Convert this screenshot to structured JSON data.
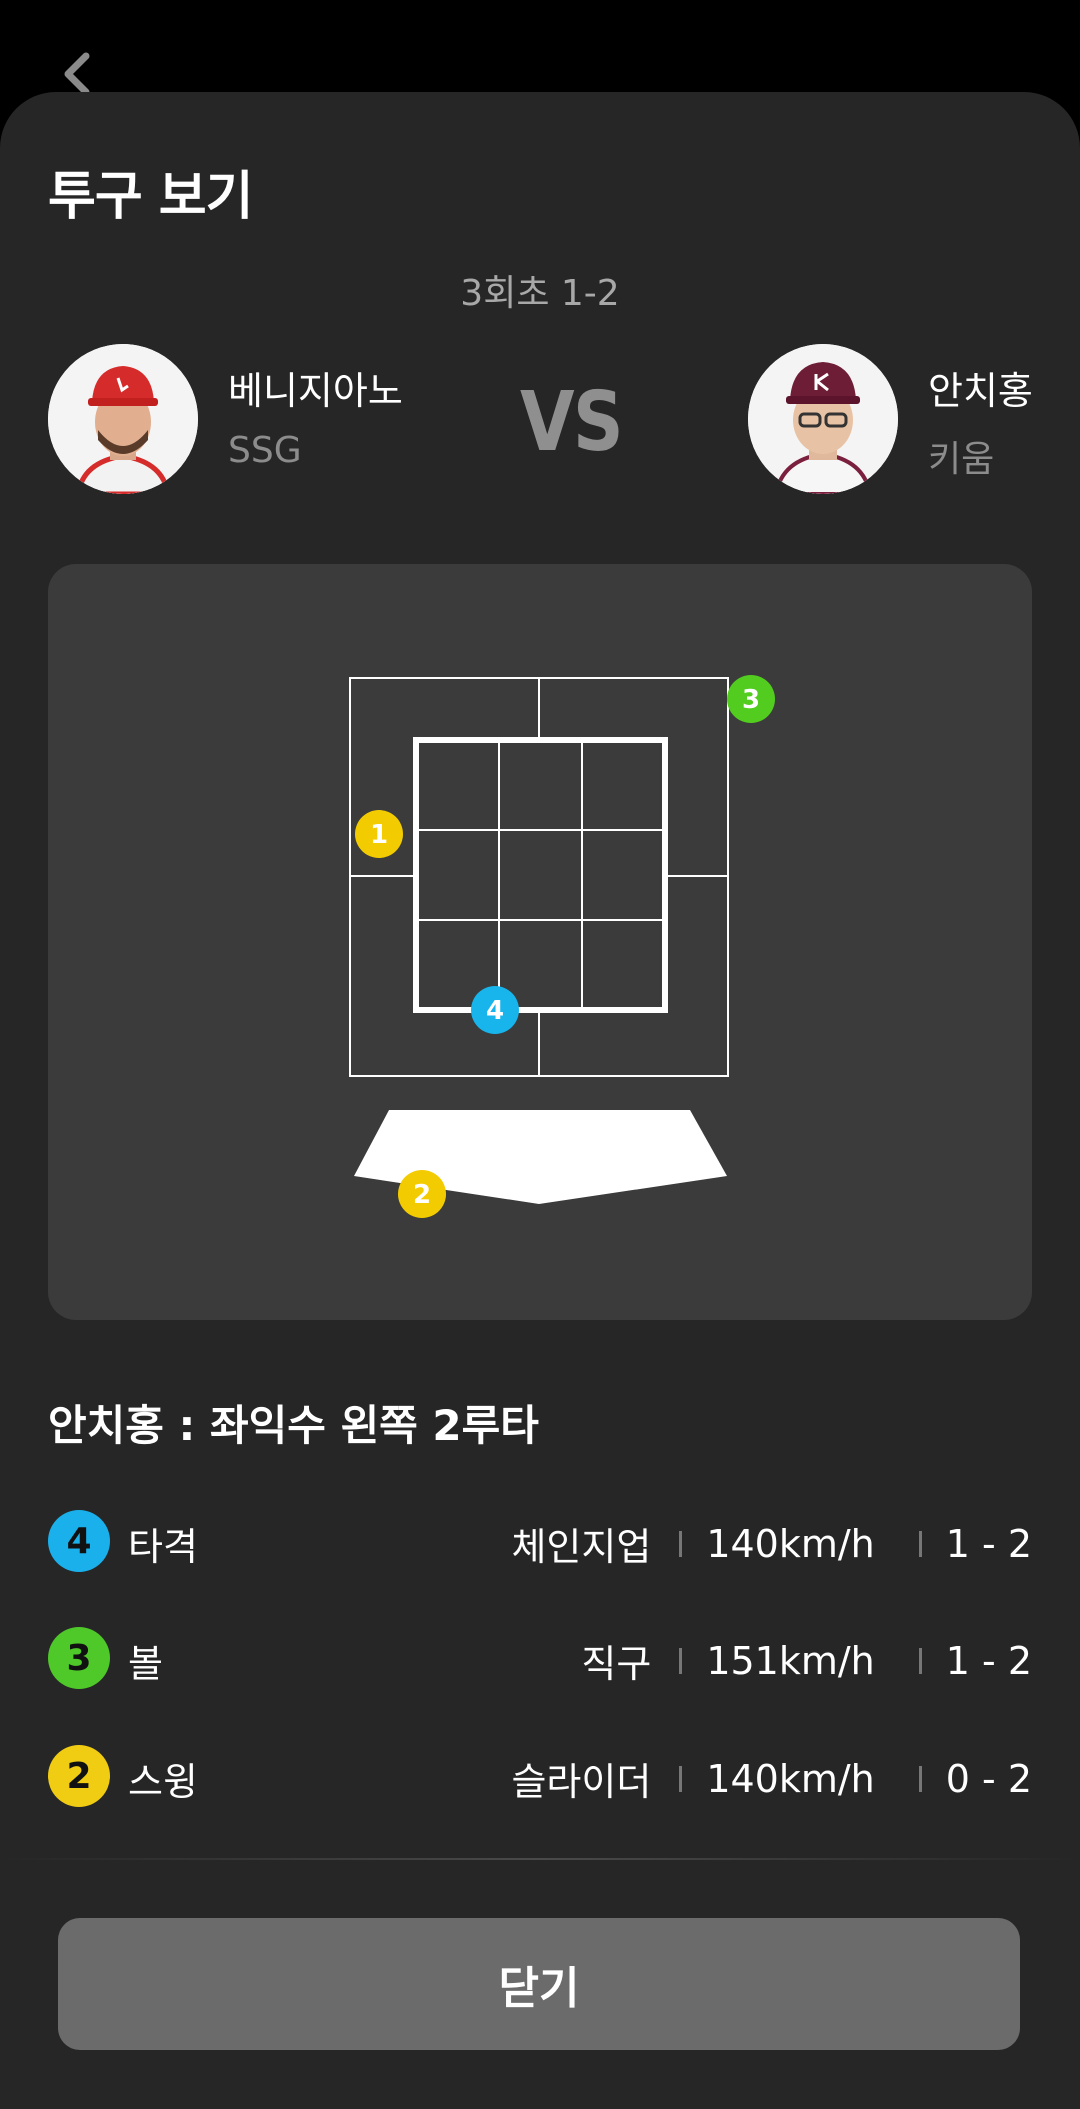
{
  "header": {
    "title": "투구 보기",
    "inning": "3회초 1-2"
  },
  "matchup": {
    "pitcher": {
      "name": "베니지아노",
      "team": "SSG"
    },
    "vs": "VS",
    "batter": {
      "name": "안치홍",
      "team": "키움"
    }
  },
  "strike_zone": {
    "markers": [
      {
        "number": "1",
        "color": "#f2cc00"
      },
      {
        "number": "2",
        "color": "#f2cc00"
      },
      {
        "number": "3",
        "color": "#52cc1f"
      },
      {
        "number": "4",
        "color": "#18b4ec"
      }
    ]
  },
  "result": "안치홍 : 좌익수 왼쪽 2루타",
  "pitches": [
    {
      "number": "4",
      "color": "#1ab0ec",
      "result": "타격",
      "type": "체인지업",
      "speed": "140km/h",
      "count": "1 - 2"
    },
    {
      "number": "3",
      "color": "#4fc82a",
      "result": "볼",
      "type": "직구",
      "speed": "151km/h",
      "count": "1 - 2"
    },
    {
      "number": "2",
      "color": "#f0cc12",
      "result": "스윙",
      "type": "슬라이더",
      "speed": "140km/h",
      "count": "0 - 2"
    }
  ],
  "close_button": "닫기",
  "colors": {
    "sheet": "#262626",
    "panel": "#3b3b3b",
    "button": "#6b6b6b"
  }
}
